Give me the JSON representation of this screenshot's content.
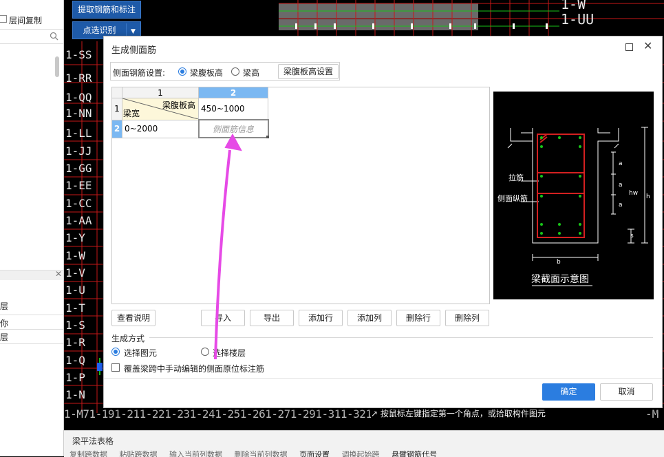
{
  "left_panel": {
    "copy_between_floors": "层间复制",
    "section_rows": [
      "层",
      "你",
      "层"
    ]
  },
  "toolbar": {
    "extract_btn": "提取钢筋和标注",
    "pick_btn": "点选识别"
  },
  "axis_labels": [
    "1-SS",
    "1-RR",
    "1-QQ",
    "1-NN",
    "1-LL",
    "1-JJ",
    "1-GG",
    "1-EE",
    "1-CC",
    "1-AA",
    "1-Y",
    "1-W",
    "1-V",
    "1-U",
    "1-T",
    "1-S",
    "1-R",
    "1-Q",
    "1-P",
    "1-N"
  ],
  "axis_labels_right": [
    "1-W",
    "1-UU"
  ],
  "cad_bottom_text": "1-M71-191-211-221-231-241-251-261-271-291-311-321",
  "cad_bottom_text_right": "-M",
  "status_hint": "按鼠标左键指定第一个角点，或拾取构件图元",
  "bottom_bar": {
    "title": "梁平法表格",
    "items": [
      "复制跨数据",
      "粘贴跨数据",
      "输入当前列数据",
      "删除当前列数据",
      "页面设置",
      "调换起始跨",
      "悬臂钢筋代号"
    ]
  },
  "dialog": {
    "title": "生成侧面筋",
    "setting_label": "侧面钢筋设置:",
    "radio_web_height": "梁腹板高",
    "radio_beam_height": "梁高",
    "web_height_settings_btn": "梁腹板高设置",
    "table": {
      "col_headers": [
        "1",
        "2"
      ],
      "row_headers": [
        "1",
        "2"
      ],
      "corner_top": "梁腹板高",
      "corner_bottom": "梁宽",
      "header_value": "450~1000",
      "row2_value": "0~2000",
      "placeholder": "侧面筋信息"
    },
    "buttons": {
      "view_help": "查看说明",
      "import": "导入",
      "export": "导出",
      "add_row": "添加行",
      "add_col": "添加列",
      "delete_row": "删除行",
      "delete_col": "删除列",
      "ok": "确定",
      "cancel": "取消"
    },
    "generate_mode_label": "生成方式",
    "radio_select_element": "选择图元",
    "radio_select_floor": "选择楼层",
    "checkbox_override": "覆盖梁跨中手动编辑的侧面原位标注筋",
    "diagram": {
      "tie_bar": "拉筋",
      "side_long_bar": "侧面纵筋",
      "dim_a": "a",
      "dim_hw": "hw",
      "dim_h": "h",
      "dim_s": "s",
      "dim_b": "b",
      "caption": "梁截面示意图"
    }
  },
  "colors": {
    "accent": "#2b7de0",
    "header_blue": "#7bb8f2",
    "corner_yellow": "#fdf7da",
    "arrow_magenta": "#e64ae6",
    "cad_red": "#d42020",
    "cad_green": "#18c418"
  }
}
